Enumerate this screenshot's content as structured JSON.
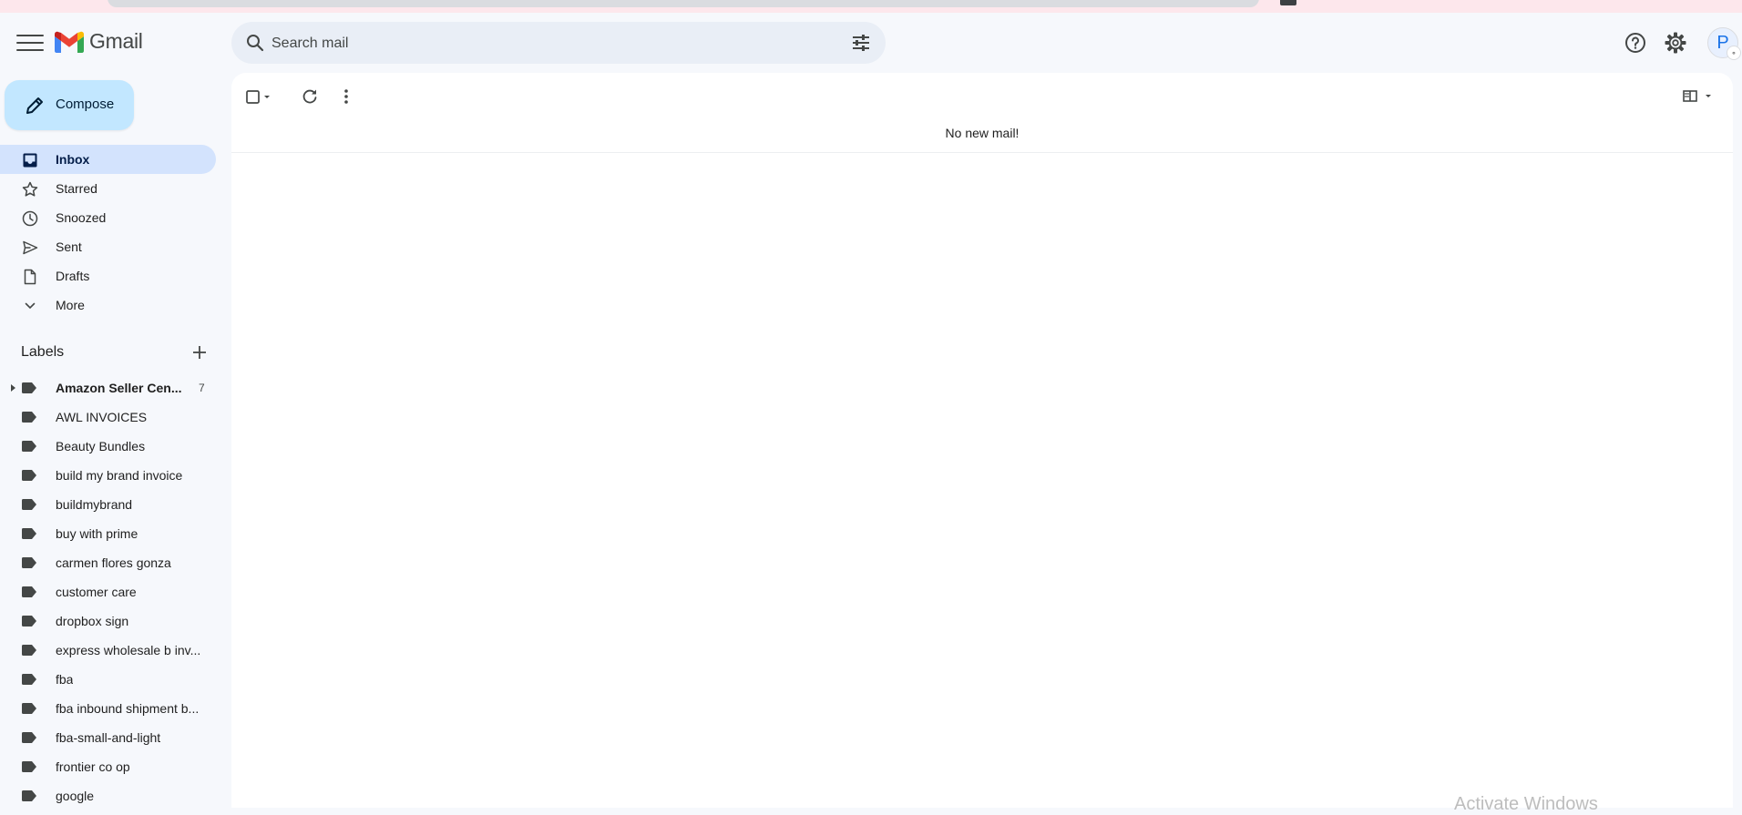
{
  "app": {
    "name": "Gmail"
  },
  "search": {
    "placeholder": "Search mail"
  },
  "compose": {
    "label": "Compose"
  },
  "nav": [
    {
      "label": "Inbox",
      "icon": "inbox-icon",
      "active": true
    },
    {
      "label": "Starred",
      "icon": "star-icon"
    },
    {
      "label": "Snoozed",
      "icon": "clock-icon"
    },
    {
      "label": "Sent",
      "icon": "send-icon"
    },
    {
      "label": "Drafts",
      "icon": "draft-icon"
    },
    {
      "label": "More",
      "icon": "chevron-down-icon"
    }
  ],
  "labels": {
    "heading": "Labels",
    "items": [
      {
        "name": "Amazon Seller Cen...",
        "count": "7",
        "bold": true,
        "expandable": true
      },
      {
        "name": "AWL INVOICES"
      },
      {
        "name": "Beauty Bundles"
      },
      {
        "name": "build my brand invoice"
      },
      {
        "name": "buildmybrand"
      },
      {
        "name": "buy with prime"
      },
      {
        "name": "carmen flores gonza"
      },
      {
        "name": "customer care"
      },
      {
        "name": "dropbox sign"
      },
      {
        "name": "express wholesale b inv..."
      },
      {
        "name": "fba"
      },
      {
        "name": "fba inbound shipment b..."
      },
      {
        "name": "fba-small-and-light"
      },
      {
        "name": "frontier co op"
      },
      {
        "name": "google"
      }
    ]
  },
  "main": {
    "empty_message": "No new mail!"
  },
  "user": {
    "avatar_letter": "P"
  },
  "watermark": "Activate Windows",
  "colors": {
    "background": "#f6f8fc",
    "compose": "#c2e7ff",
    "active_nav": "#d3e3fd",
    "search": "#e9eef6"
  }
}
